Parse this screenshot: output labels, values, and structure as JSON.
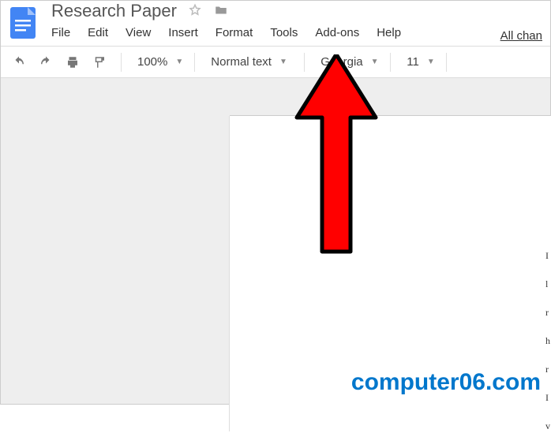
{
  "header": {
    "title": "Research Paper",
    "menu": [
      "File",
      "Edit",
      "View",
      "Insert",
      "Format",
      "Tools",
      "Add-ons",
      "Help"
    ],
    "changes_label": "All chan"
  },
  "toolbar": {
    "zoom": "100%",
    "paragraph_style": "Normal text",
    "font": "Georgia",
    "font_size": "11"
  },
  "page": {
    "snippet_lines": [
      "I",
      "l",
      "r",
      "h",
      "r",
      "I",
      "v"
    ]
  },
  "watermark": "computer06.com"
}
